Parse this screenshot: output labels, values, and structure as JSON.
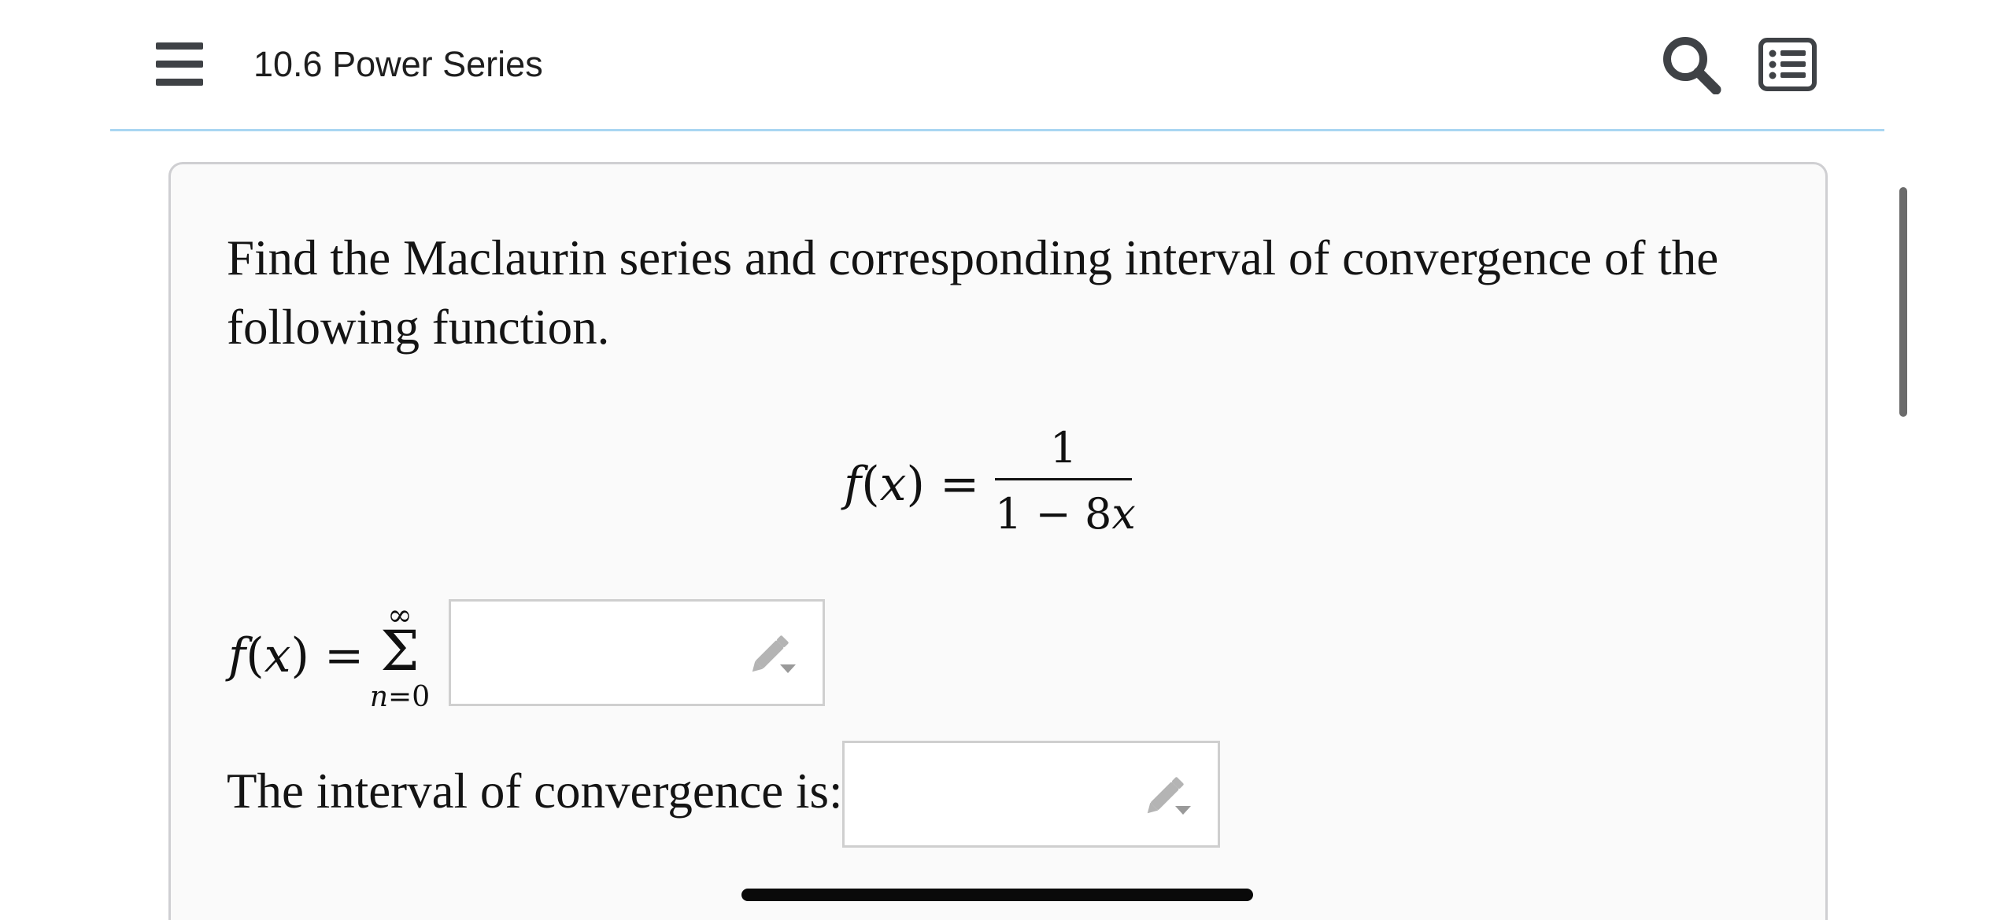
{
  "header": {
    "title": "10.6 Power Series",
    "menu_icon": "hamburger-menu-icon",
    "search_icon": "search-icon",
    "contents_icon": "table-of-contents-icon",
    "rule_color": "#a9d6f2"
  },
  "question": {
    "prompt": "Find the Maclaurin series and corresponding interval of convergence of the following function.",
    "function": {
      "lhs_name": "f",
      "lhs_var": "x",
      "equals": "=",
      "numerator": "1",
      "denominator_const": "1",
      "denominator_op": "−",
      "denominator_coef": "8",
      "denominator_var": "x"
    },
    "series": {
      "lhs_name": "f",
      "lhs_var": "x",
      "equals": "=",
      "sum_symbol": "Σ",
      "upper_limit": "∞",
      "lower_limit_var": "n",
      "lower_limit_eq": "=",
      "lower_limit_val": "0",
      "answer_value": "",
      "edit_icon": "pencil-edit-icon"
    },
    "interval": {
      "label": "The interval of convergence is:",
      "answer_value": "",
      "edit_icon": "pencil-edit-icon"
    }
  }
}
